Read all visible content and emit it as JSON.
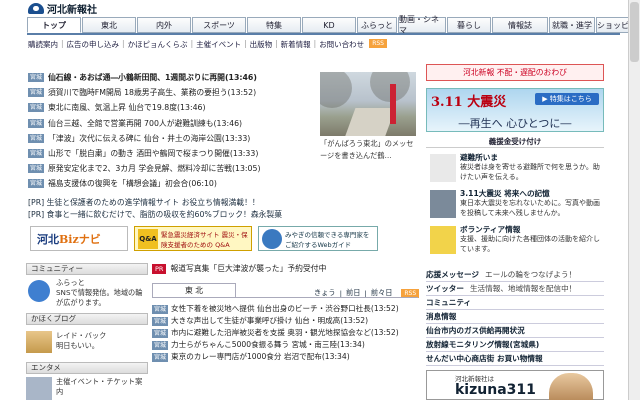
{
  "header": {
    "logo_text": "河北新報社"
  },
  "nav": {
    "tabs": [
      {
        "label": "トップ",
        "w": 54,
        "active": true
      },
      {
        "label": "東北",
        "w": 54
      },
      {
        "label": "内外",
        "w": 54
      },
      {
        "label": "スポーツ",
        "w": 54
      },
      {
        "label": "特集",
        "w": 54
      },
      {
        "label": "KD",
        "w": 54
      },
      {
        "label": "ふらっと",
        "w": 40
      },
      {
        "label": "動画・シネマ",
        "w": 48
      },
      {
        "label": "暮らし",
        "w": 44
      },
      {
        "label": "情報誌",
        "w": 56
      },
      {
        "label": "就職・進学",
        "w": 46
      },
      {
        "label": "ショッピング",
        "w": 50
      }
    ]
  },
  "subnav": [
    "購読案内",
    "広告の申し込み",
    "かほピョんくらぶ",
    "主催イベント",
    "出版物",
    "新着情報",
    "お問い合わせ"
  ],
  "subnav_rss": "RSS",
  "news": [
    {
      "tag": "宮城",
      "text": "仙石線・あおば通―小鶴新田間、1週間ぶりに再開(13:46)"
    },
    {
      "tag": "宮城",
      "text": "須賀川で臨時FM開局 18歳男子高生、業務の要担う(13:52)"
    },
    {
      "tag": "宮城",
      "text": "東北に南風、気温上昇 仙台で19.8度(13:46)"
    },
    {
      "tag": "宮城",
      "text": "仙台三越、全館で営業再開 700人が避難訓練も(13:46)"
    },
    {
      "tag": "宮城",
      "text": "「津波」次代に伝える碑に 仙台・井土の海岸公園(13:33)"
    },
    {
      "tag": "宮城",
      "text": "山形で「脱自粛」の動き 酒田や鶴岡で桜まつり開催(13:33)"
    },
    {
      "tag": "宮城",
      "text": "原発安定化まで2、3カ月 学会見解、燃料冷却に苦戦(13:05)"
    },
    {
      "tag": "宮城",
      "text": "福島支援体の復興を「構想会議」初会合(06:10)"
    }
  ],
  "photo_caption": "「がんばろう東北」のメッセージを書き込んだ鶴…",
  "pr": [
    "[PR] 生徒と保護者のための進学情報サイト お役立ち情報満載！！",
    "[PR] 食事と一緒に飲むだけで、脂肪の吸収を約60%ブロック！森永製菓"
  ],
  "banners": {
    "biz_left": "河北",
    "biz_right": "Bizナビ",
    "qa_label": "Q&A",
    "qa_text": "緊急震災経済サイト 震災・保険支援者のための Q&A",
    "miyagi_text": "みやぎの信頼できる専門家をご紹介するWebガイド"
  },
  "left": {
    "community": {
      "title": "コミュニティー",
      "name": "ふらっと",
      "desc": "SNSで情報発信。地域の輪が広がります。"
    },
    "blog": {
      "title": "かほくブログ",
      "name": "レイド・バック",
      "desc": "明日もいい。"
    },
    "entame": {
      "title": "エンタメ",
      "desc": "主催イベント・チケット案内"
    }
  },
  "center": {
    "press_tag": "PR",
    "press_text": "報道写真集「巨大津波が襲った」予約受付中",
    "tab": "東 北",
    "links": [
      "きょう",
      "前日",
      "前々日"
    ],
    "rss": "RSS",
    "news": [
      {
        "tag": "宮城",
        "text": "女性下着を被災地へ提供 仙台出身のビーチ・渋谷野口社長(13:52)"
      },
      {
        "tag": "宮城",
        "text": "大きな声出して生徒が事業呼び掛け 仙台・明成高(13:52)"
      },
      {
        "tag": "宮城",
        "text": "市内に避難した沿岸被災者を支援 奥羽・観光地探協会など(13:52)"
      },
      {
        "tag": "宮城",
        "text": "力士らがちゃんこ5000食振る舞う 宮城・南三陸(13:34)"
      },
      {
        "tag": "宮城",
        "text": "東京のカレー専門店が1000食分 岩沼で配布(13:34)"
      }
    ]
  },
  "right": {
    "header": "河北新報 不配・遅配のおわび",
    "eq_title": "3.11 大震災",
    "eq_button": "▶ 特集はこちら",
    "eq_slogan": "―再生へ 心ひとつに―",
    "gisen": "義援金受け付け",
    "items": [
      {
        "title": "避難所いま",
        "desc": "被災者は身を寄せる避難所で何を思うか。助けたい声を伝える。"
      },
      {
        "title": "3.11大震災 将来への記憶",
        "desc": "東日本大震災を忘れないために。写真や動画を投稿して未来へ残しませんか。"
      },
      {
        "title": "ボランティア情報",
        "desc": "支援、援助に向けた各種団体の活動を紹介しています。"
      }
    ],
    "list": [
      {
        "b": "応援メッセージ",
        "s": "エールの輪をつなげよう！"
      },
      {
        "b": "ツイッター",
        "s": "生活情報、地域情報を配信中！"
      },
      {
        "b": "コミュニティ",
        "s": ""
      },
      {
        "b": "消息情報",
        "s": ""
      },
      {
        "b": "仙台市内のガス供給再開状況",
        "s": ""
      },
      {
        "b": "放射線モニタリング情報(宮城県)",
        "s": ""
      },
      {
        "b": "せんだい中心商店街 お買い物情報",
        "s": ""
      }
    ],
    "ad_small": "河北新報社は",
    "ad_big": "kizuna311"
  },
  "colors": {
    "accent": "#5a7ea8",
    "tag": "#6f8fb0",
    "alert": "#c8102e"
  }
}
